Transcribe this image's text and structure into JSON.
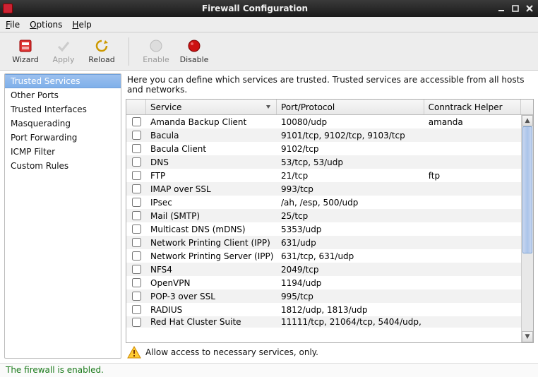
{
  "window": {
    "title": "Firewall Configuration"
  },
  "menu": {
    "file": "File",
    "options": "Options",
    "help": "Help"
  },
  "toolbar": {
    "wizard": "Wizard",
    "apply": "Apply",
    "reload": "Reload",
    "enable": "Enable",
    "disable": "Disable"
  },
  "sidebar": {
    "items": [
      "Trusted Services",
      "Other Ports",
      "Trusted Interfaces",
      "Masquerading",
      "Port Forwarding",
      "ICMP Filter",
      "Custom Rules"
    ],
    "selected": 0
  },
  "description": "Here you can define which services are trusted. Trusted services are accessible from all hosts and networks.",
  "columns": {
    "service": "Service",
    "port": "Port/Protocol",
    "conn": "Conntrack Helper"
  },
  "services": [
    {
      "name": "Amanda Backup Client",
      "port": "10080/udp",
      "conn": "amanda"
    },
    {
      "name": "Bacula",
      "port": "9101/tcp, 9102/tcp, 9103/tcp",
      "conn": ""
    },
    {
      "name": "Bacula Client",
      "port": "9102/tcp",
      "conn": ""
    },
    {
      "name": "DNS",
      "port": "53/tcp, 53/udp",
      "conn": ""
    },
    {
      "name": "FTP",
      "port": "21/tcp",
      "conn": "ftp"
    },
    {
      "name": "IMAP over SSL",
      "port": "993/tcp",
      "conn": ""
    },
    {
      "name": "IPsec",
      "port": "/ah, /esp, 500/udp",
      "conn": ""
    },
    {
      "name": "Mail (SMTP)",
      "port": "25/tcp",
      "conn": ""
    },
    {
      "name": "Multicast DNS (mDNS)",
      "port": "5353/udp",
      "conn": ""
    },
    {
      "name": "Network Printing Client (IPP)",
      "port": "631/udp",
      "conn": ""
    },
    {
      "name": "Network Printing Server (IPP)",
      "port": "631/tcp, 631/udp",
      "conn": ""
    },
    {
      "name": "NFS4",
      "port": "2049/tcp",
      "conn": ""
    },
    {
      "name": "OpenVPN",
      "port": "1194/udp",
      "conn": ""
    },
    {
      "name": "POP-3 over SSL",
      "port": "995/tcp",
      "conn": ""
    },
    {
      "name": "RADIUS",
      "port": "1812/udp, 1813/udp",
      "conn": ""
    },
    {
      "name": "Red Hat Cluster Suite",
      "port": "11111/tcp, 21064/tcp, 5404/udp,",
      "conn": ""
    }
  ],
  "hint": "Allow access to necessary services, only.",
  "status": "The firewall is enabled."
}
